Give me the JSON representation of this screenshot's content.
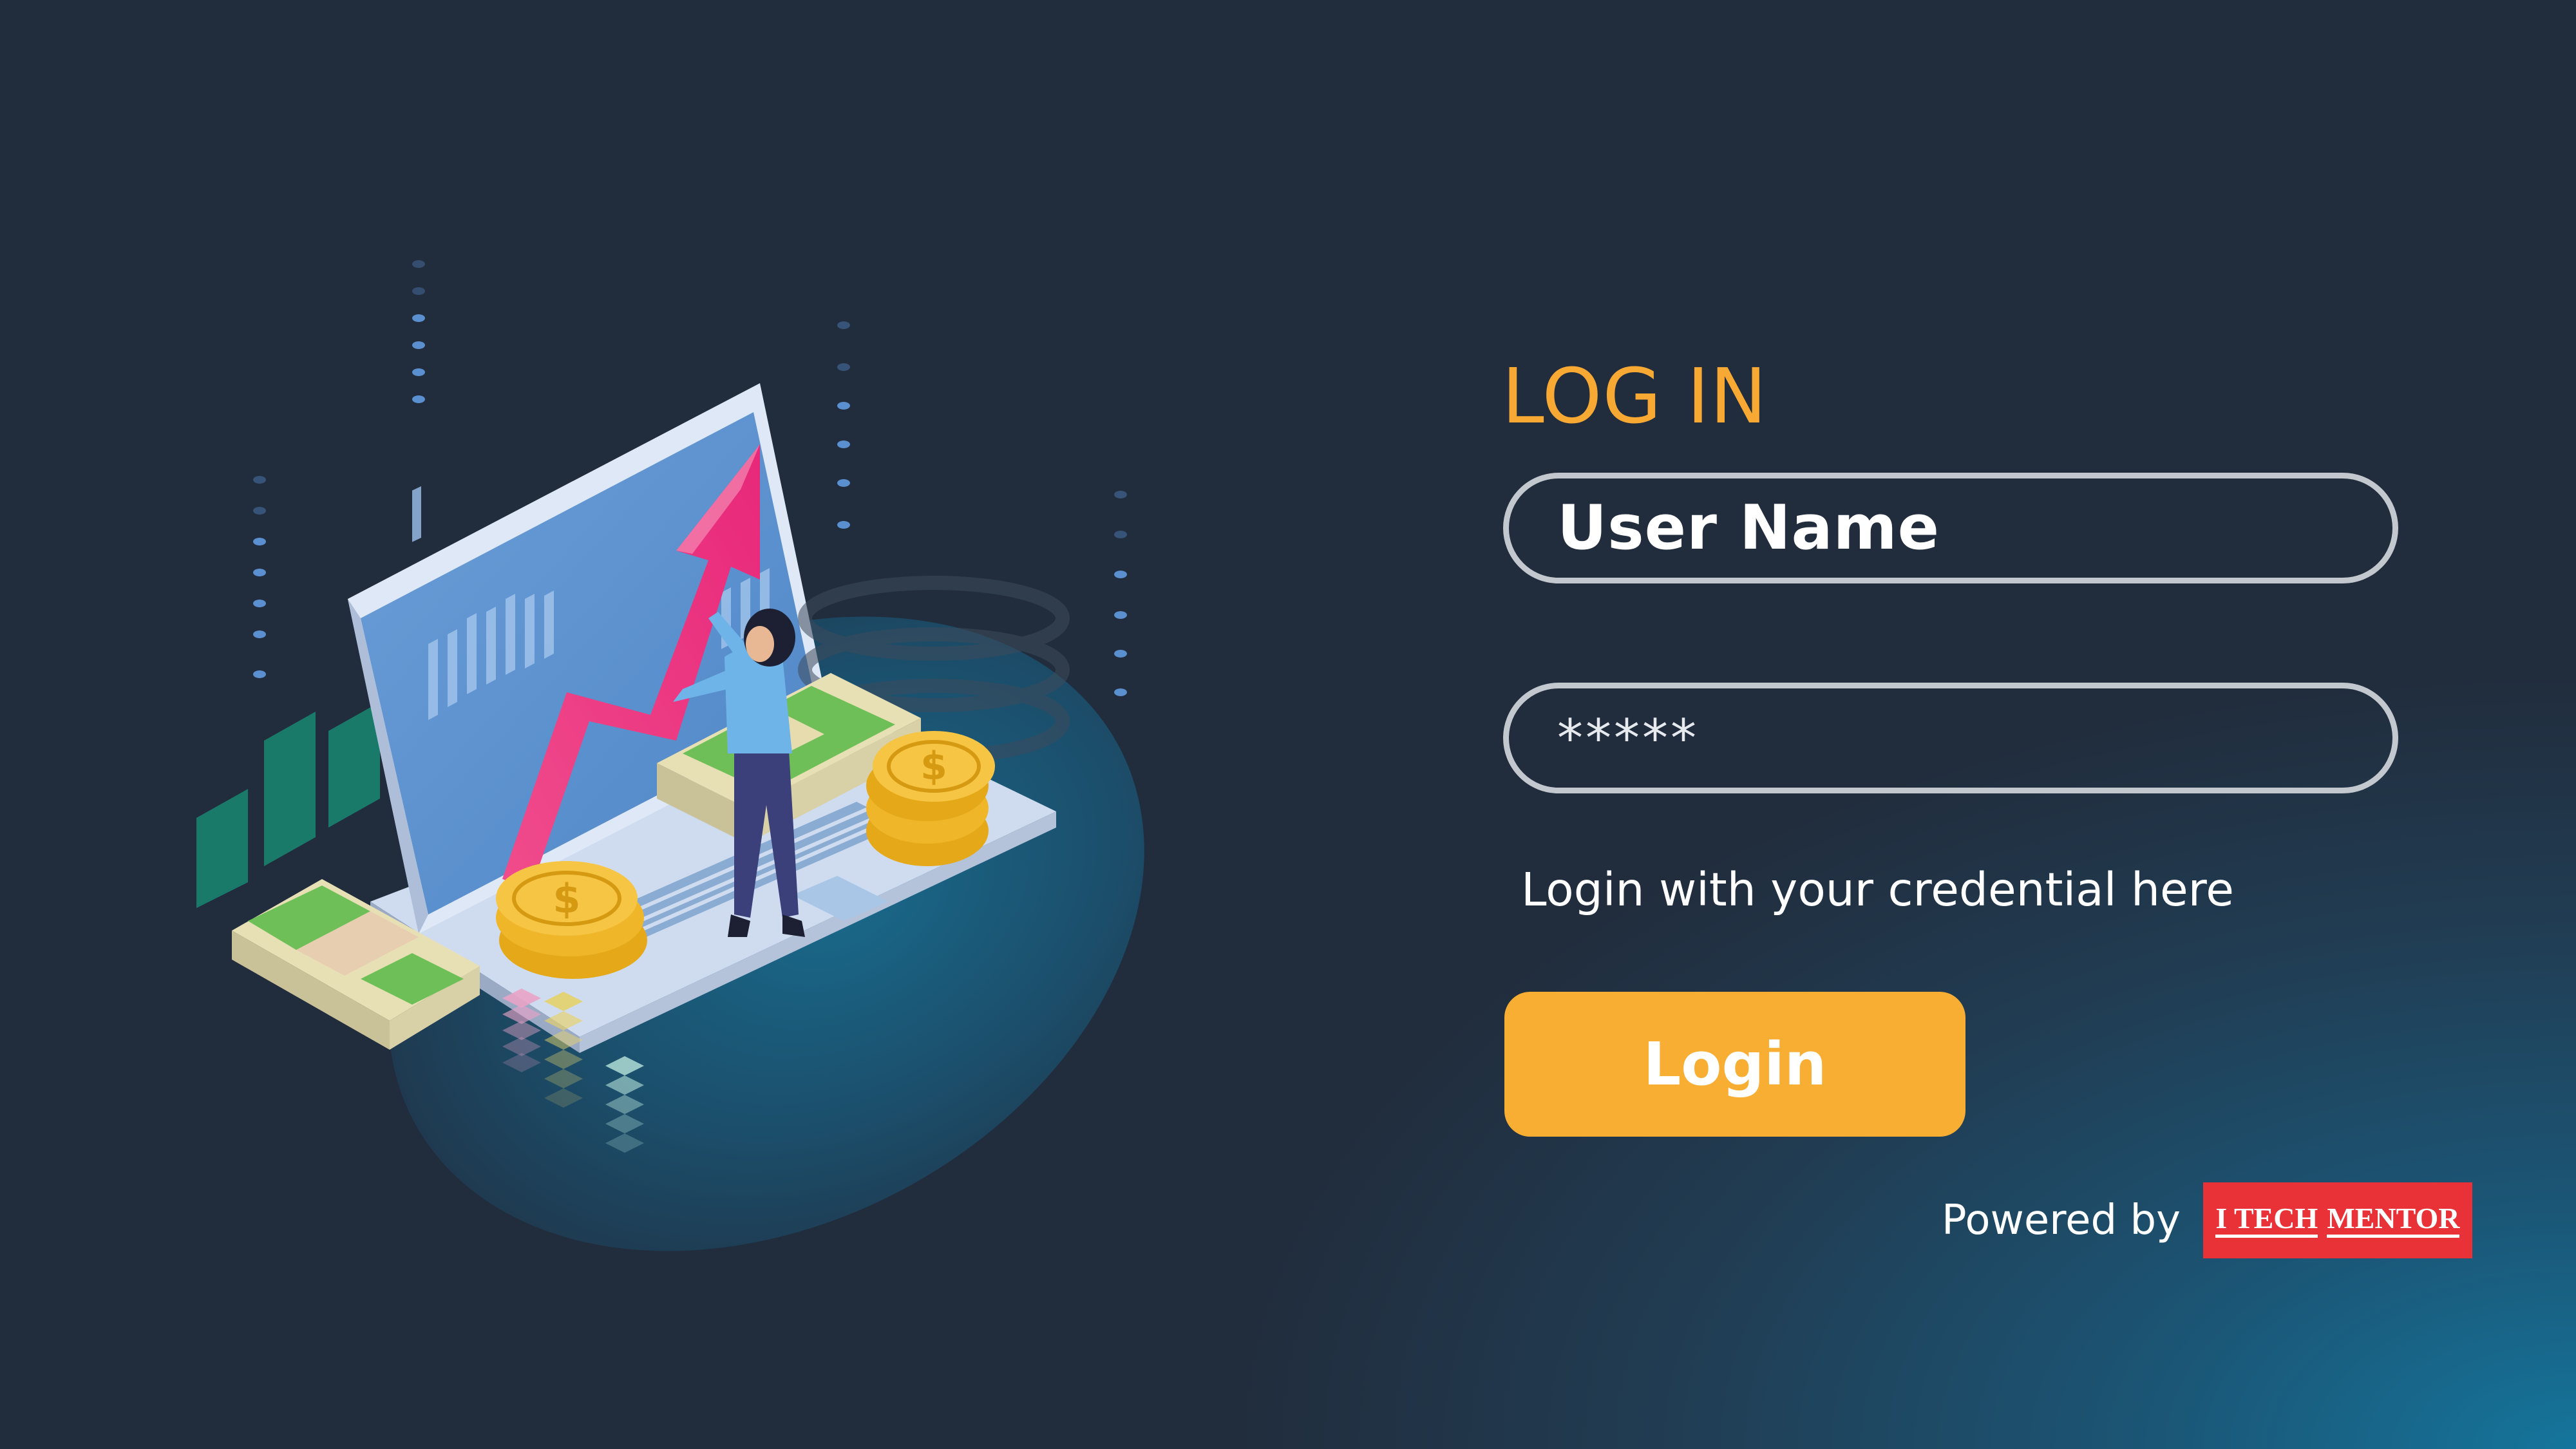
{
  "login": {
    "title": "LOG IN",
    "username_text": "User Name",
    "password_text": "*****",
    "hint": "Login with your credential here",
    "button_label": "Login"
  },
  "footer": {
    "powered_by": "Powered by",
    "brand_left": "I TECH",
    "brand_right": "MENTOR"
  },
  "colors": {
    "accent": "#f7a933",
    "button": "#f8ad33",
    "field_border": "#c3c8cf",
    "brand_red": "#e93238",
    "background_dark": "#212c3c",
    "background_teal": "#15759c"
  },
  "illustration": {
    "description_icons": [
      "laptop-icon",
      "growth-arrow-icon",
      "cash-stack-icon",
      "coin-stack-icon",
      "woman-figure-icon",
      "bar-chart-icon"
    ]
  }
}
